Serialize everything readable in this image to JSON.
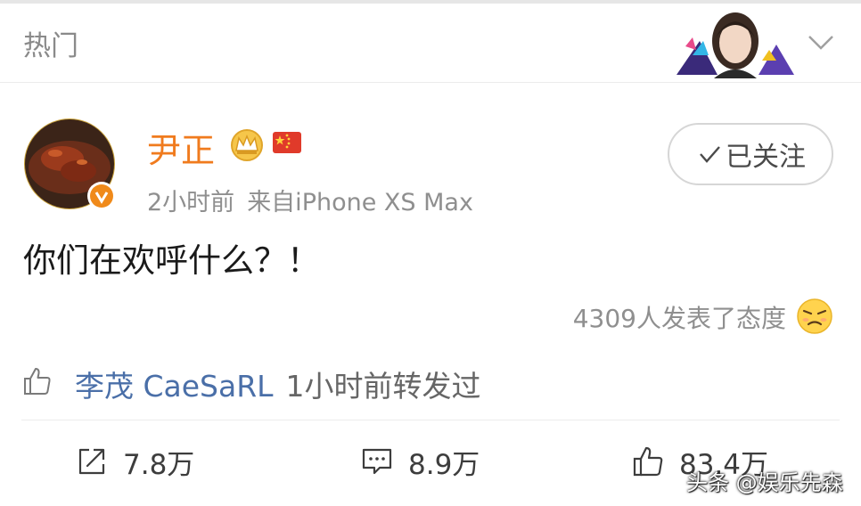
{
  "header": {
    "section_title": "热门"
  },
  "post": {
    "author": "尹正",
    "time": "2小时前",
    "source": "来自iPhone XS Max",
    "text": "你们在欢呼什么？！",
    "follow_label": "已关注",
    "reactions": "4309人发表了态度"
  },
  "repost": {
    "user": "李茂 CaeSaRL",
    "action": "1小时前转发过"
  },
  "actions": {
    "share_count": "7.8万",
    "comment_count": "8.9万",
    "like_count": "83.4万"
  },
  "watermark": "头条 @娱乐先森",
  "colors": {
    "author_orange": "#f07b1e",
    "link_blue": "#4a6fa8",
    "muted_gray": "#8f8f8f",
    "divider": "#ececec"
  }
}
